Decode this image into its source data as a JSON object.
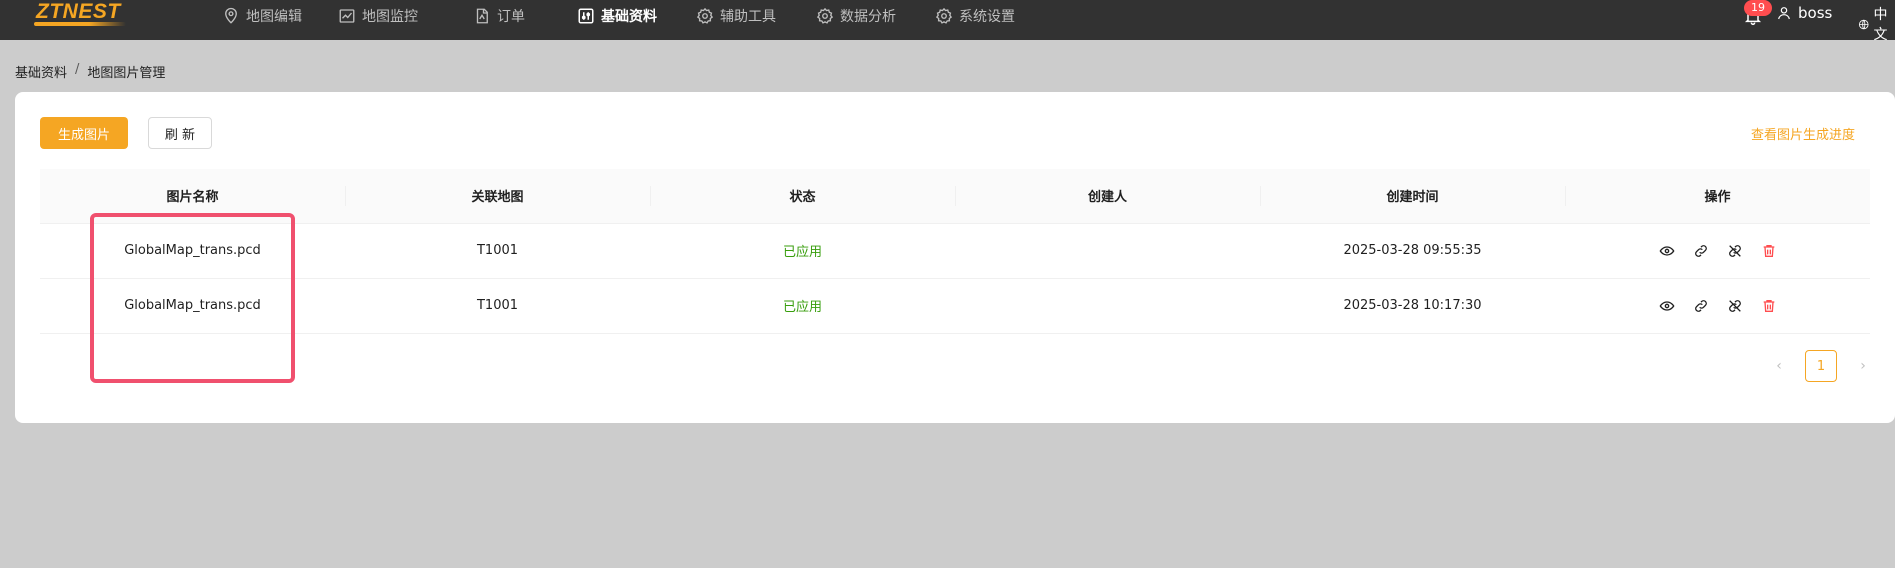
{
  "app": {
    "logo_text": "ZTNEST"
  },
  "nav": [
    {
      "label": "地图编辑",
      "icon": "location-pin-icon",
      "active": false
    },
    {
      "label": "地图监控",
      "icon": "line-chart-icon",
      "active": false
    },
    {
      "label": "订单",
      "icon": "document-icon",
      "active": false
    },
    {
      "label": "基础资料",
      "icon": "sliders-icon",
      "active": true
    },
    {
      "label": "辅助工具",
      "icon": "gear-icon",
      "active": false
    },
    {
      "label": "数据分析",
      "icon": "gear-icon",
      "active": false
    },
    {
      "label": "系统设置",
      "icon": "gear-icon",
      "active": false
    }
  ],
  "header": {
    "notification_count": "19",
    "username": "boss",
    "language": "中文"
  },
  "breadcrumb": {
    "parent": "基础资料",
    "separator": "/",
    "current": "地图图片管理"
  },
  "toolbar": {
    "generate_label": "生成图片",
    "refresh_label": "刷 新",
    "progress_link": "查看图片生成进度"
  },
  "table": {
    "columns": [
      "图片名称",
      "关联地图",
      "状态",
      "创建人",
      "创建时间",
      "操作"
    ],
    "rows": [
      {
        "name": "GlobalMap_trans.pcd",
        "map": "T1001",
        "status": "已应用",
        "creator": "",
        "created": "2025-03-28 09:55:35"
      },
      {
        "name": "GlobalMap_trans.pcd",
        "map": "T1001",
        "status": "已应用",
        "creator": "",
        "created": "2025-03-28 10:17:30"
      }
    ],
    "row_actions": [
      "eye-icon",
      "link-icon",
      "unlink-icon",
      "delete-icon"
    ]
  },
  "pagination": {
    "current_page": "1",
    "prev": "‹",
    "next": "›"
  },
  "colors": {
    "accent": "#f5a623",
    "topbar": "#323232",
    "status_ok": "#389e0d",
    "danger": "#ff4d4f",
    "highlight": "#f0506e"
  }
}
